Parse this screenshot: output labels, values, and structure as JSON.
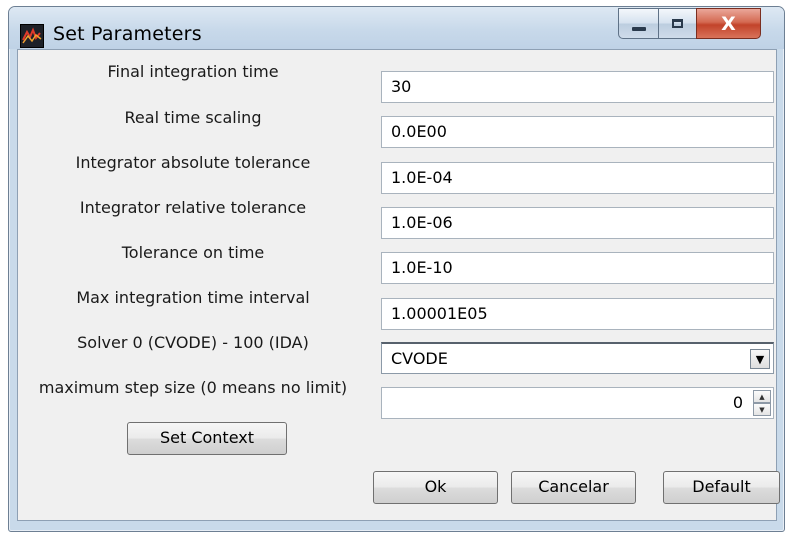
{
  "window": {
    "title": "Set Parameters",
    "close_glyph": "X"
  },
  "params": [
    {
      "label": "Final integration time",
      "value": "30"
    },
    {
      "label": "Real time scaling",
      "value": "0.0E00"
    },
    {
      "label": "Integrator absolute tolerance",
      "value": "1.0E-04"
    },
    {
      "label": "Integrator relative tolerance",
      "value": "1.0E-06"
    },
    {
      "label": "Tolerance on time",
      "value": "1.0E-10"
    },
    {
      "label": "Max integration time interval",
      "value": "1.00001E05"
    }
  ],
  "solver": {
    "label": "Solver 0 (CVODE) - 100 (IDA)",
    "selected": "CVODE"
  },
  "max_step": {
    "label": "maximum step size (0 means no limit)",
    "value": "0"
  },
  "buttons": {
    "set_context": "Set Context",
    "ok": "Ok",
    "cancel": "Cancelar",
    "default": "Default"
  }
}
